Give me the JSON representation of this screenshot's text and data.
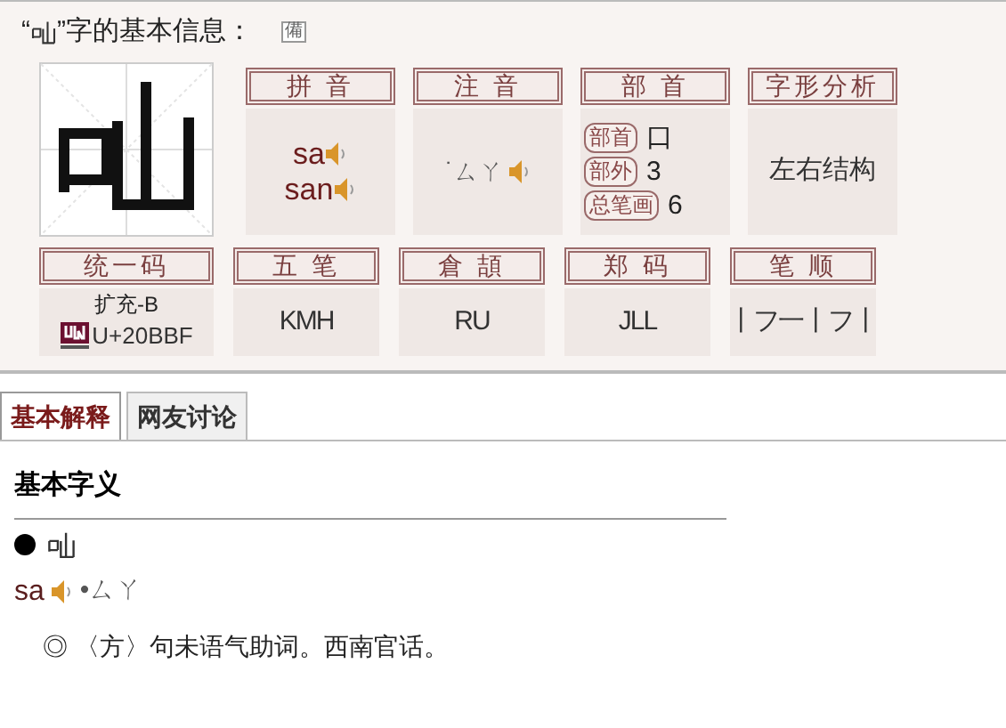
{
  "title_open": "“",
  "title_close": "”字的基本信息：",
  "title_icon_label": "備",
  "row1": [
    {
      "kind": "pinyin",
      "header": "拼 音",
      "readings": [
        {
          "text": "sa"
        },
        {
          "text": "san"
        }
      ]
    },
    {
      "kind": "zhuyin",
      "header": "注 音",
      "value": "˙ㄙㄚ"
    },
    {
      "kind": "radical",
      "header": "部 首",
      "entries": [
        {
          "label": "部首",
          "value": "口"
        },
        {
          "label": "部外",
          "value": "3"
        },
        {
          "label": "总笔画",
          "value": "6"
        }
      ]
    },
    {
      "kind": "text",
      "header": "字形分析",
      "value": "左右结构"
    }
  ],
  "row2": [
    {
      "kind": "unicode",
      "header": "统一码",
      "block": "扩充-B",
      "code": "U+20BBF"
    },
    {
      "kind": "text",
      "header": "五 笔",
      "value": "KMH"
    },
    {
      "kind": "text",
      "header": "倉 頡",
      "value": "RU"
    },
    {
      "kind": "text",
      "header": "郑 码",
      "value": "JLL"
    },
    {
      "kind": "text",
      "header": "笔 顺",
      "value": "丨フ一丨フ丨"
    }
  ],
  "tabs": [
    {
      "label": "基本解释",
      "selected": true
    },
    {
      "label": "网友讨论",
      "selected": false
    }
  ],
  "section_heading": "基本字义",
  "entry": {
    "pinyin": "sa",
    "zhuyin": "•ㄙㄚ",
    "definitions": [
      "◎ 〈方〉句未语气助词。西南官话。"
    ]
  }
}
